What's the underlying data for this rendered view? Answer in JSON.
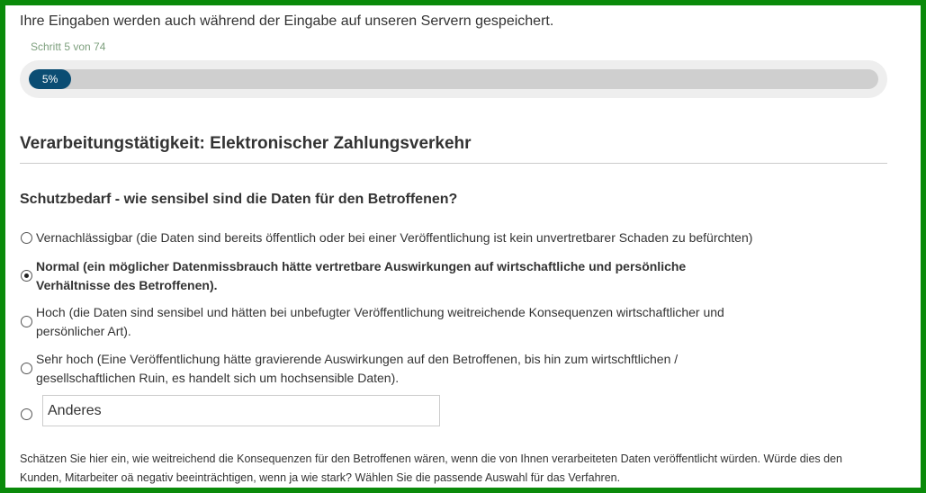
{
  "notice": "Ihre Eingaben werden auch während der Eingabe auf unseren Servern gespeichert.",
  "progress": {
    "step_label": "Schritt 5 von 74",
    "percent": 5,
    "percent_label": "5%"
  },
  "section_title": "Verarbeitungstätigkeit: Elektronischer Zahlungsverkehr",
  "question": "Schutzbedarf - wie sensibel sind die Daten für den Betroffenen?",
  "options": [
    {
      "label": "Vernachlässigbar (die Daten sind bereits öffentlich oder bei einer Veröffentlichung ist kein unvertretbarer Schaden zu befürchten)",
      "selected": false
    },
    {
      "label": "Normal (ein möglicher Datenmissbrauch hätte vertretbare Auswirkungen auf wirtschaftliche und persönliche Verhältnisse des Betroffenen).",
      "selected": true
    },
    {
      "label": "Hoch (die Daten sind sensibel und hätten bei unbefugter Veröffentlichung weitreichende Konsequenzen wirtschaftlicher und persönlicher Art).",
      "selected": false
    },
    {
      "label": "Sehr hoch (Eine Veröffentlichung hätte gravierende Auswirkungen auf den Betroffenen, bis hin zum wirtschftlichen / gesellschaftlichen Ruin, es handelt sich um hochsensible Daten).",
      "selected": false
    }
  ],
  "other": {
    "value": "Anderes",
    "selected": false
  },
  "help_text": "Schätzen Sie hier ein, wie weitreichend die Konsequenzen für den Betroffenen wären, wenn die von Ihnen verarbeiteten Daten veröffentlicht würden. Würde dies den Kunden, Mitarbeiter oä negativ beeinträchtigen, wenn ja wie stark? Wählen Sie die passende Auswahl für das Verfahren.",
  "colors": {
    "frame": "#0a8a0a",
    "progress_fill": "#0b4d73",
    "step_label": "#7ea07e"
  }
}
